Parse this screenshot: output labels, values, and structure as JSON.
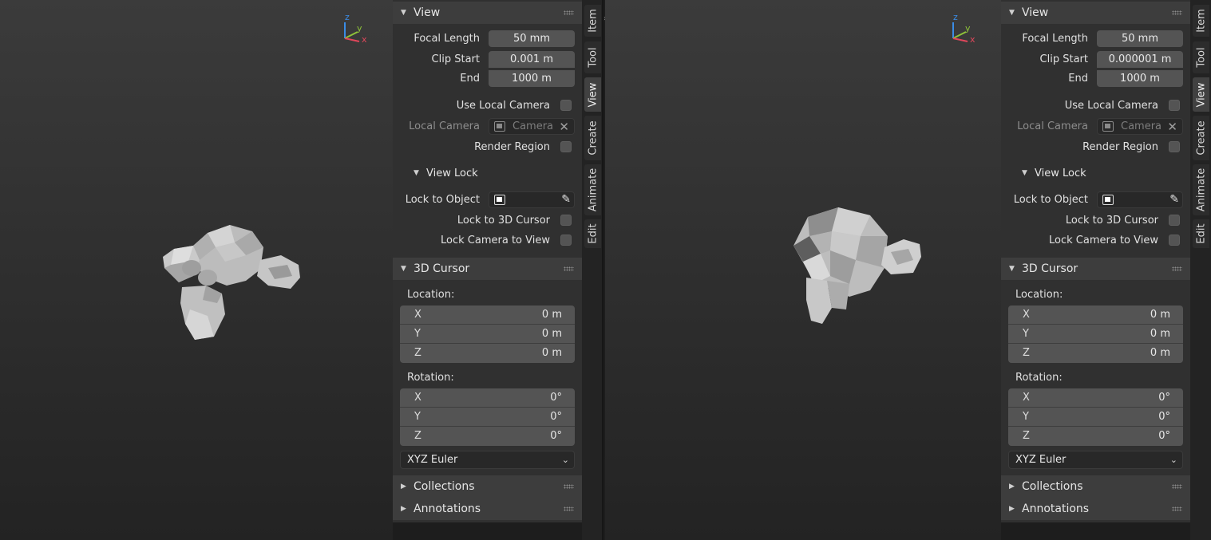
{
  "panes": [
    {
      "id": "left",
      "axes": {
        "z": "z",
        "y": "y",
        "x": "x"
      },
      "view": {
        "title": "View",
        "focal_length_label": "Focal Length",
        "focal_length": "50 mm",
        "clip_start_label": "Clip Start",
        "clip_start": "0.001 m",
        "clip_end_label": "End",
        "clip_end": "1000 m",
        "use_local_camera": "Use Local Camera",
        "local_camera_label": "Local Camera",
        "local_camera_value": "Camera",
        "render_region": "Render Region"
      },
      "view_lock": {
        "title": "View Lock",
        "lock_to_object": "Lock to Object",
        "lock_to_cursor": "Lock to 3D Cursor",
        "lock_camera": "Lock Camera to View"
      },
      "cursor": {
        "title": "3D Cursor",
        "location_label": "Location:",
        "location": [
          {
            "axis": "X",
            "value": "0 m"
          },
          {
            "axis": "Y",
            "value": "0 m"
          },
          {
            "axis": "Z",
            "value": "0 m"
          }
        ],
        "rotation_label": "Rotation:",
        "rotation": [
          {
            "axis": "X",
            "value": "0°"
          },
          {
            "axis": "Y",
            "value": "0°"
          },
          {
            "axis": "Z",
            "value": "0°"
          }
        ],
        "rotation_mode": "XYZ Euler"
      },
      "collections": "Collections",
      "annotations": "Annotations",
      "tabs": [
        "Item",
        "Tool",
        "View",
        "Create",
        "Animate",
        "Edit"
      ],
      "active_tab": "View"
    },
    {
      "id": "right",
      "axes": {
        "z": "z",
        "y": "y",
        "x": "x"
      },
      "view": {
        "title": "View",
        "focal_length_label": "Focal Length",
        "focal_length": "50 mm",
        "clip_start_label": "Clip Start",
        "clip_start": "0.000001 m",
        "clip_end_label": "End",
        "clip_end": "1000 m",
        "use_local_camera": "Use Local Camera",
        "local_camera_label": "Local Camera",
        "local_camera_value": "Camera",
        "render_region": "Render Region"
      },
      "view_lock": {
        "title": "View Lock",
        "lock_to_object": "Lock to Object",
        "lock_to_cursor": "Lock to 3D Cursor",
        "lock_camera": "Lock Camera to View"
      },
      "cursor": {
        "title": "3D Cursor",
        "location_label": "Location:",
        "location": [
          {
            "axis": "X",
            "value": "0 m"
          },
          {
            "axis": "Y",
            "value": "0 m"
          },
          {
            "axis": "Z",
            "value": "0 m"
          }
        ],
        "rotation_label": "Rotation:",
        "rotation": [
          {
            "axis": "X",
            "value": "0°"
          },
          {
            "axis": "Y",
            "value": "0°"
          },
          {
            "axis": "Z",
            "value": "0°"
          }
        ],
        "rotation_mode": "XYZ Euler"
      },
      "collections": "Collections",
      "annotations": "Annotations",
      "tabs": [
        "Item",
        "Tool",
        "View",
        "Create",
        "Animate",
        "Edit"
      ],
      "active_tab": "View"
    }
  ],
  "colors": {
    "axis_x": "#e0475b",
    "axis_y": "#8fc43a",
    "axis_z": "#3a8ce6",
    "panel_bg": "#303030",
    "field_bg": "#545454"
  },
  "icons": {
    "panel_collapse": "triangle-down-icon",
    "panel_closed": "triangle-right-icon",
    "object": "object-icon",
    "eyedropper": "eyedropper-icon",
    "clear": "x-icon",
    "grip": "drag-grip-icon"
  }
}
